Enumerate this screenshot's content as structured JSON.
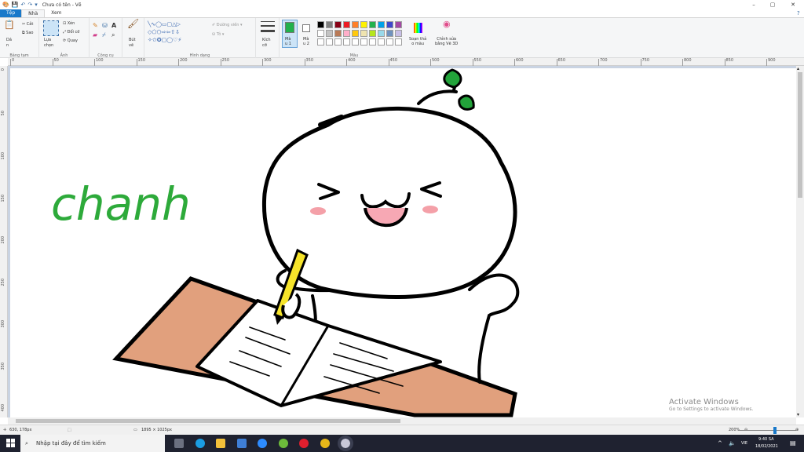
{
  "window": {
    "title": "Chưa có tên - Vẽ",
    "qa_icons": [
      "paint-app-icon",
      "save-icon",
      "undo-icon",
      "redo-icon",
      "customize-arrow-icon"
    ]
  },
  "tabs": [
    {
      "label": "Tệp"
    },
    {
      "label": "Nhà"
    },
    {
      "label": "Xem"
    }
  ],
  "ribbon": {
    "clipboard": {
      "paste": "Dá\nn",
      "cut": "Cắt",
      "copy": "Sao",
      "label": "Bảng tạm"
    },
    "image": {
      "select": "Lựa\nchọn",
      "crop": "Xén",
      "resize": "Đổi cỡ",
      "rotate": "Quay",
      "label": "Ảnh"
    },
    "tools": {
      "label": "Công cụ"
    },
    "brushes": {
      "label": "Bút\nvẽ"
    },
    "shapes": {
      "outline": "Đường viền",
      "fill": "Tô",
      "label": "Hình dạng"
    },
    "size": {
      "label": "Kích\ncỡ"
    },
    "colors": {
      "color1": "Mà\nu 1",
      "color2": "Mà\nu 2",
      "edit": "Soạn thả\no màu",
      "paint3d": "Chỉnh sửa\nbằng Vẽ 3D",
      "label": "Màu",
      "active_color": "#22b14c",
      "palette": [
        "#000000",
        "#7f7f7f",
        "#880015",
        "#ed1c24",
        "#ff7f27",
        "#fff200",
        "#22b14c",
        "#00a2e8",
        "#3f48cc",
        "#a349a4",
        "#ffffff",
        "#c3c3c3",
        "#b97a57",
        "#ffaec9",
        "#ffc90e",
        "#efe4b0",
        "#b5e61d",
        "#99d9ea",
        "#7092be",
        "#c8bfe7",
        "#ffffff",
        "#ffffff",
        "#ffffff",
        "#ffffff",
        "#ffffff",
        "#ffffff",
        "#ffffff",
        "#ffffff",
        "#ffffff",
        "#ffffff"
      ]
    }
  },
  "ruler": {
    "top": [
      "0",
      "50",
      "100",
      "150",
      "200",
      "250",
      "300",
      "350",
      "400",
      "450",
      "500",
      "550",
      "600",
      "650",
      "700",
      "750",
      "800",
      "850",
      "900"
    ],
    "left": [
      "0",
      "50",
      "100",
      "150",
      "200",
      "250",
      "300",
      "350",
      "400"
    ]
  },
  "drawing": {
    "text": "chanh",
    "text_color": "#2daa3a",
    "desk_color": "#e1a07d",
    "pencil_color": "#f6e42a",
    "leaf_color": "#22a33a",
    "blush_color": "#f4a0a8"
  },
  "status": {
    "cursor": "630, 178px",
    "size": "1895 × 1025px",
    "zoom": "200%"
  },
  "watermark": {
    "line1": "Activate Windows",
    "line2": "Go to Settings to activate Windows."
  },
  "taskbar": {
    "search_placeholder": "Nhập tại đây để tìm kiếm",
    "apps": [
      "task-view-icon",
      "edge-icon",
      "file-explorer-icon",
      "mail-icon",
      "zoom-icon",
      "chat-app-icon",
      "opera-icon",
      "chrome-icon",
      "paint-app-icon"
    ],
    "lang": "VIE",
    "time": "9:40 SA",
    "date": "18/02/2021"
  }
}
